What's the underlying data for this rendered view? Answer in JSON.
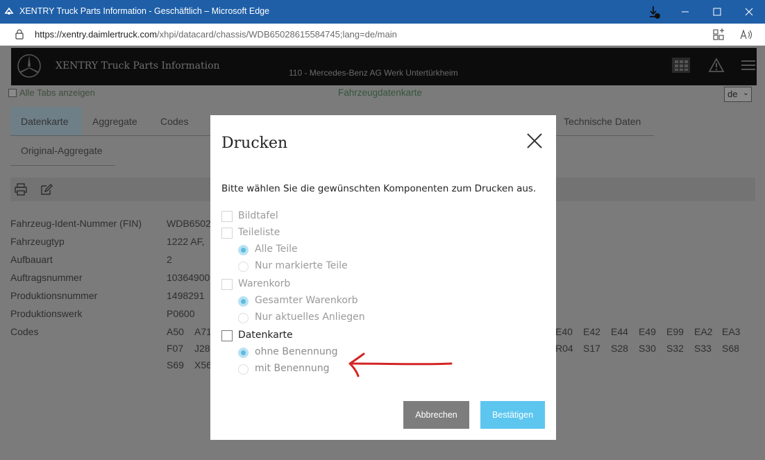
{
  "window": {
    "title": "XENTRY Truck Parts Information - Geschäftlich – Microsoft Edge",
    "url_host": "https://xentry.daimlertruck.com",
    "url_path": "/xhpi/datacard/chassis/WDB65028615584745;lang=de/main"
  },
  "header": {
    "brand": "XENTRY Truck Parts Information",
    "plant": "110 - Mercedes-Benz AG Werk Untertürkheim"
  },
  "subheader": {
    "all_tabs": "Alle Tabs anzeigen",
    "page_title": "Fahrzeugdatenkarte",
    "language": "de"
  },
  "tabs": [
    "Datenkarte",
    "Aggregate",
    "Codes",
    "Technische Daten",
    "Original-Aggregate"
  ],
  "vehicle": {
    "labels": [
      "Fahrzeug-Ident-Nummer (FIN)",
      "Fahrzeugtyp",
      "Aufbauart",
      "Auftragsnummer",
      "Produktionsnummer",
      "Produktionswerk",
      "Codes"
    ],
    "values": [
      "WDB6502",
      "1222 AF,",
      "2",
      "10364900",
      "1498291",
      "P0600"
    ]
  },
  "codes": {
    "row1_left": [
      "A50",
      "A71"
    ],
    "row1_right": [
      "E40",
      "E42",
      "E44",
      "E49",
      "E99",
      "EA2",
      "EA3"
    ],
    "row2_left": [
      "F07",
      "J28"
    ],
    "row2_right": [
      "R04",
      "S17",
      "S28",
      "S30",
      "S32",
      "S33",
      "S68"
    ],
    "row3_left": [
      "S69",
      "X56"
    ]
  },
  "dialog": {
    "title": "Drucken",
    "instruction": "Bitte wählen Sie die gewünschten Komponenten zum Drucken aus.",
    "options": {
      "bildtafel": "Bildtafel",
      "teileliste": "Teileliste",
      "alle_teile": "Alle Teile",
      "nur_markierte": "Nur markierte Teile",
      "warenkorb": "Warenkorb",
      "gesamter_warenkorb": "Gesamter Warenkorb",
      "nur_aktuelles": "Nur aktuelles Anliegen",
      "datenkarte": "Datenkarte",
      "ohne_benennung": "ohne Benennung",
      "mit_benennung": "mit Benennung"
    },
    "cancel_label": "Abbrechen",
    "confirm_label": "Bestätigen"
  },
  "colors": {
    "titlebar": "#1f5fa8",
    "accent": "#5cc6ef",
    "annotation_arrow": "#d42424"
  }
}
